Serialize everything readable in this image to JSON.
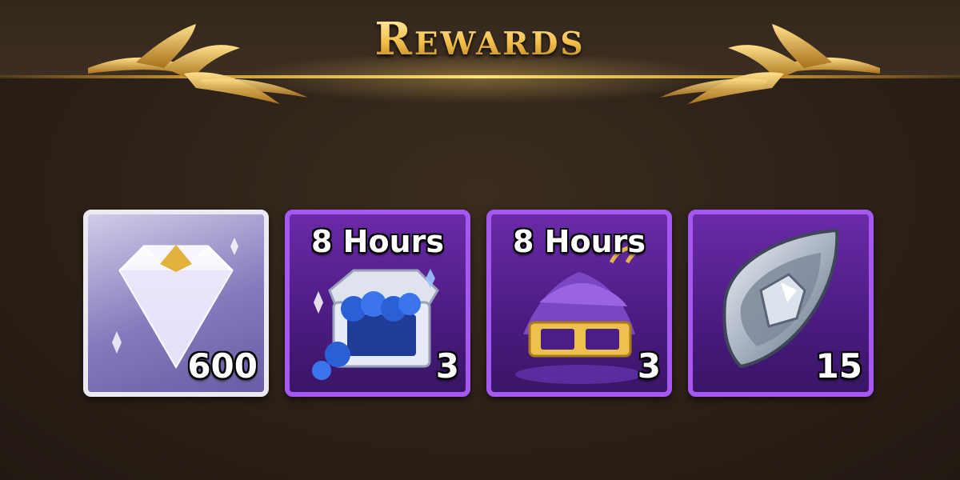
{
  "header": {
    "title": "Rewards"
  },
  "rewards": [
    {
      "icon": "diamond-icon",
      "duration": "",
      "quantity": "600",
      "frame": "silver"
    },
    {
      "icon": "treasure-chest-icon",
      "duration": "8 Hours",
      "quantity": "3",
      "frame": "purple"
    },
    {
      "icon": "purple-dust-chest-icon",
      "duration": "8 Hours",
      "quantity": "3",
      "frame": "purple"
    },
    {
      "icon": "silver-stone-icon",
      "duration": "",
      "quantity": "15",
      "frame": "purple"
    }
  ],
  "colors": {
    "gold_accent": "#f5c04a",
    "purple_frame": "#a557f2",
    "silver_frame": "#ece9f2",
    "background": "#2c2118"
  }
}
